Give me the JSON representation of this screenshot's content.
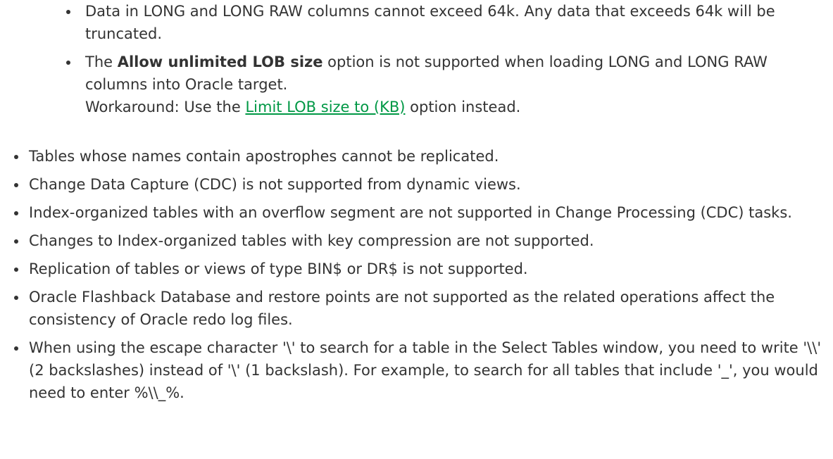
{
  "colors": {
    "text": "#333333",
    "link": "#009845"
  },
  "sub_items": {
    "item0": {
      "text": "Data in LONG and LONG RAW columns cannot exceed 64k. Any data that exceeds 64k will be truncated."
    },
    "item1": {
      "before": "The ",
      "bold": "Allow unlimited LOB size",
      "after": " option is not supported when loading LONG and LONG RAW columns into Oracle target.",
      "workaround_before": "Workaround: Use the ",
      "workaround_link": "Limit LOB size to (KB)",
      "workaround_after": " option instead."
    }
  },
  "items": [
    "Tables whose names contain apostrophes cannot be replicated.",
    "Change Data Capture (CDC) is not supported from dynamic views.",
    "Index-organized tables with an overflow segment are not supported in Change Processing (CDC) tasks.",
    "Changes to Index-organized tables with key compression are not supported.",
    "Replication of tables or views of type BIN$ or DR$ is not supported.",
    "Oracle Flashback Database and restore points are not supported as the related operations affect the consistency of Oracle redo log files.",
    "When using the escape character '\\' to search for a table in the Select Tables window, you need to write '\\\\' (2 backslashes) instead of '\\' (1 backslash). For example, to search for all tables that include '_', you would need to enter %\\\\_%."
  ]
}
